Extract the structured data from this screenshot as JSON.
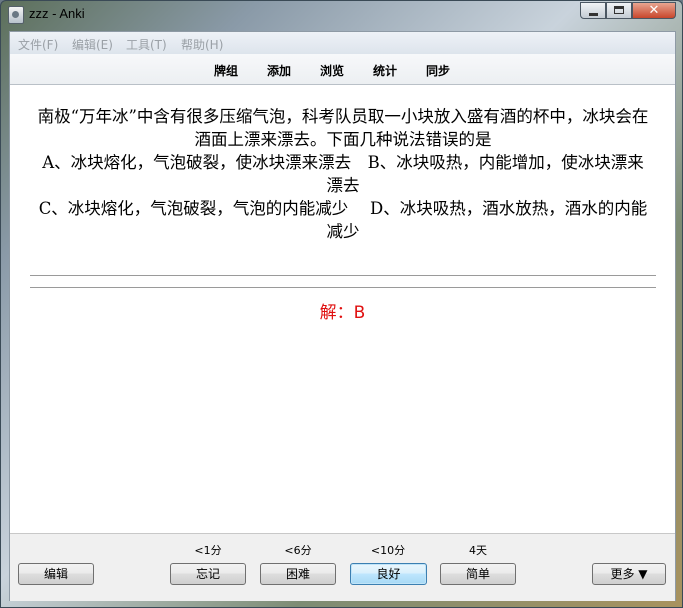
{
  "window": {
    "title": "zzz - Anki"
  },
  "menu": [
    {
      "label": "文件(F)"
    },
    {
      "label": "编辑(E)"
    },
    {
      "label": "工具(T)"
    },
    {
      "label": "帮助(H)"
    }
  ],
  "toolbar": [
    {
      "label": "牌组"
    },
    {
      "label": "添加"
    },
    {
      "label": "浏览"
    },
    {
      "label": "统计"
    },
    {
      "label": "同步"
    }
  ],
  "card": {
    "question_lines": [
      "南极“万年冰”中含有很多压缩气泡，科考队员取一小块放入盛有酒的杯中，冰块会在酒面上漂来漂去。下面几种说法错误的是",
      "A、冰块熔化，气泡破裂，使冰块漂来漂去　B、冰块吸热，内能增加，使冰块漂来漂去",
      "C、冰块熔化，气泡破裂，气泡的内能减少　 D、冰块吸热，酒水放热，酒水的内能减少"
    ],
    "answer": "解：B"
  },
  "bottom": {
    "edit_label": "编辑",
    "more_label": "更多 ▼",
    "answers": [
      {
        "interval": "<1分",
        "label": "忘记"
      },
      {
        "interval": "<6分",
        "label": "困难"
      },
      {
        "interval": "<10分",
        "label": "良好"
      },
      {
        "interval": "4天",
        "label": "简单"
      }
    ]
  }
}
